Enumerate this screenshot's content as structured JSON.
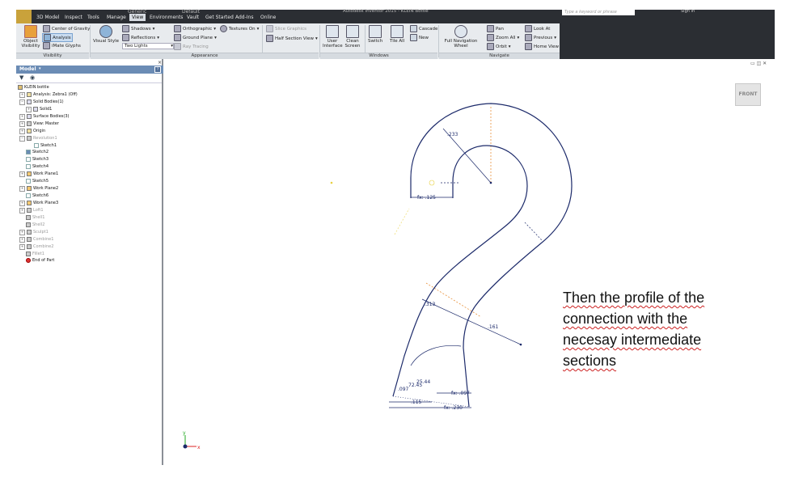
{
  "title_bar": {
    "title": "Autodesk Inventor 2015 - KLEIN Bottle",
    "search_placeholder": "Type a keyword or phrase",
    "sign_in": "Sign In",
    "quick_combos": [
      "Generic",
      "Default"
    ]
  },
  "menu_tabs": [
    "3D Model",
    "Inspect",
    "Tools",
    "Manage",
    "View",
    "Environments",
    "Vault",
    "Get Started",
    "Add-Ins",
    "Online"
  ],
  "active_tab": "View",
  "ribbon": {
    "visibility": {
      "label": "Visibility",
      "object_visibility": "Object Visibility",
      "center_of_gravity": "Center of Gravity",
      "analysis": "Analysis",
      "imate_glyphs": "iMate Glyphs"
    },
    "appearance": {
      "label": "Appearance",
      "visual_style": "Visual Style",
      "shadows": "Shadows",
      "reflections": "Reflections",
      "lighting": "Two Lights",
      "orthographic": "Orthographic",
      "ground_plane": "Ground Plane",
      "ray_tracing": "Ray Tracing",
      "textures_on": "Textures On",
      "slice_graphics": "Slice Graphics",
      "half_section_view": "Half Section View"
    },
    "windows": {
      "label": "Windows",
      "user_interface": "User Interface",
      "clean_screen": "Clean Screen",
      "switch": "Switch",
      "tile_all": "Tile All",
      "cascade": "Cascade",
      "new": "New"
    },
    "navigate": {
      "label": "Navigate",
      "full_navigation_wheel": "Full Navigation Wheel",
      "pan": "Pan",
      "zoom_all": "Zoom All",
      "orbit": "Orbit",
      "look_at": "Look At",
      "previous": "Previous",
      "home_view": "Home View"
    }
  },
  "browser": {
    "header": "Model",
    "tree": [
      {
        "label": "KLEIN bottle",
        "icon": "part-icon",
        "dim": false
      },
      {
        "label": "Analysis: Zebra1 (Off)",
        "icon": "folder-icon",
        "dim": false
      },
      {
        "label": "Solid Bodies(1)",
        "icon": "body-icon",
        "dim": false
      },
      {
        "label": "Solid1",
        "icon": "solid-icon",
        "dim": false
      },
      {
        "label": "Surface Bodies(3)",
        "icon": "surface-icon",
        "dim": false
      },
      {
        "label": "View: Master",
        "icon": "view-icon",
        "dim": false
      },
      {
        "label": "Origin",
        "icon": "folder-icon",
        "dim": false
      },
      {
        "label": "Revolution1",
        "icon": "revolve-icon",
        "dim": true
      },
      {
        "label": "Sketch1",
        "icon": "sketch-icon",
        "dim": false
      },
      {
        "label": "Sketch2",
        "icon": "sketch-icon",
        "dim": false
      },
      {
        "label": "Sketch3",
        "icon": "sketch-icon",
        "dim": false
      },
      {
        "label": "Sketch4",
        "icon": "sketch-icon",
        "dim": false
      },
      {
        "label": "Work Plane1",
        "icon": "plane-icon",
        "dim": false
      },
      {
        "label": "Sketch5",
        "icon": "sketch-icon",
        "dim": false
      },
      {
        "label": "Work Plane2",
        "icon": "plane-icon",
        "dim": false
      },
      {
        "label": "Sketch6",
        "icon": "sketch-icon",
        "dim": false
      },
      {
        "label": "Work Plane3",
        "icon": "plane-icon",
        "dim": false
      },
      {
        "label": "Loft1",
        "icon": "loft-icon",
        "dim": true
      },
      {
        "label": "Shell1",
        "icon": "shell-icon",
        "dim": true
      },
      {
        "label": "Shell2",
        "icon": "shell-icon",
        "dim": true
      },
      {
        "label": "Sculpt1",
        "icon": "sculpt-icon",
        "dim": true
      },
      {
        "label": "Combine1",
        "icon": "combine-icon",
        "dim": true
      },
      {
        "label": "Combine2",
        "icon": "combine-icon",
        "dim": true
      },
      {
        "label": "Fillet1",
        "icon": "fillet-icon",
        "dim": true
      },
      {
        "label": "End of Part",
        "icon": "end-of-part-icon",
        "dim": false
      }
    ]
  },
  "viewport": {
    "viewcube_face": "FRONT",
    "dimensions": {
      "d1": ".233",
      "d2": "fx: .125",
      "d3": ".313",
      "d4": ".161",
      "d5": ".097",
      "d6": "72.45",
      "d7": "25.44",
      "d8": "fx: .097",
      "d9": ".115",
      "d10": "fx: .230"
    },
    "caption_lines": [
      "Then the profile of the",
      "connection with the",
      "necesay intermediate",
      "sections"
    ],
    "colors": {
      "profile": "#1c2a6a",
      "construction": "#e8913a",
      "axis_x": "#d22",
      "axis_y": "#2a2"
    }
  }
}
